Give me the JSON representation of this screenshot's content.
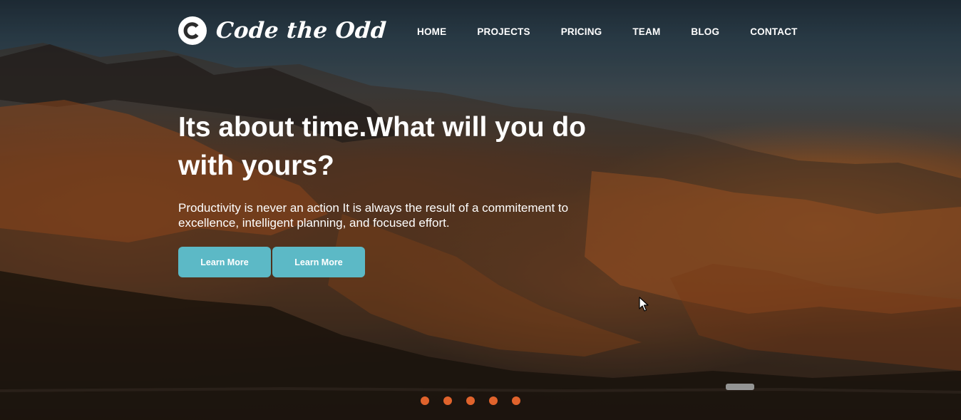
{
  "brand": {
    "logo_letter": "C",
    "name": "Code the Odd"
  },
  "nav": {
    "items": [
      {
        "label": "HOME"
      },
      {
        "label": "PROJECTS"
      },
      {
        "label": "PRICING"
      },
      {
        "label": "TEAM"
      },
      {
        "label": "BLOG"
      },
      {
        "label": "CONTACT"
      }
    ]
  },
  "hero": {
    "title": "Its about time.What will you do with yours?",
    "subtitle": "Productivity is never an action It is always the result of a commitement to excellence, intelligent planning, and focused effort.",
    "buttons": [
      {
        "label": "Learn More"
      },
      {
        "label": "Learn More"
      }
    ]
  },
  "slider": {
    "dot_count": 5,
    "dot_color": "#e0632c"
  },
  "colors": {
    "accent_button": "#5cb9c6",
    "text": "#ffffff"
  },
  "icons": {
    "logo": "c-circle-logo-icon",
    "cursor": "mouse-pointer-icon"
  }
}
